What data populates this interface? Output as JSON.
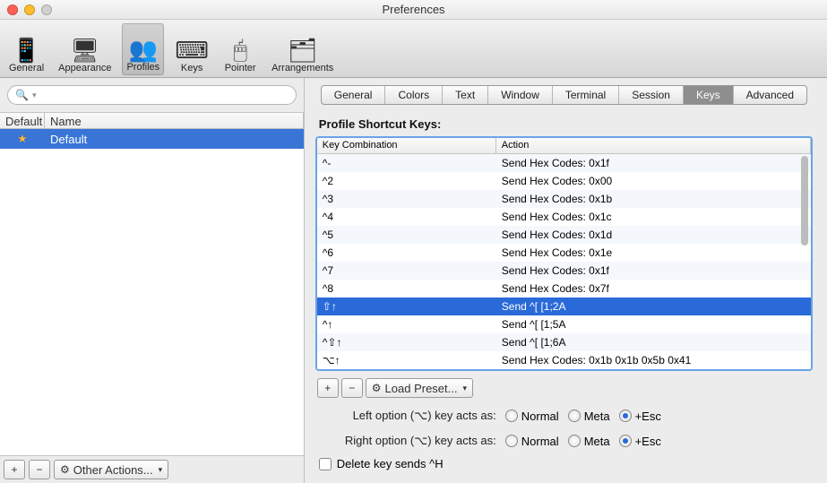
{
  "window_title": "Preferences",
  "toolbar": {
    "items": [
      {
        "label": "General",
        "icon": "📱"
      },
      {
        "label": "Appearance",
        "icon": "🖥"
      },
      {
        "label": "Profiles",
        "icon": "👥"
      },
      {
        "label": "Keys",
        "icon": "⌨"
      },
      {
        "label": "Pointer",
        "icon": "🖱"
      },
      {
        "label": "Arrangements",
        "icon": "🗂"
      }
    ],
    "selected": "Profiles"
  },
  "profiles": {
    "columns": {
      "default": "Default",
      "name": "Name"
    },
    "rows": [
      {
        "default": true,
        "name": "Default"
      }
    ],
    "buttons": {
      "add": "+",
      "remove": "−",
      "other": "Other Actions..."
    }
  },
  "right_tabs": {
    "items": [
      "General",
      "Colors",
      "Text",
      "Window",
      "Terminal",
      "Session",
      "Keys",
      "Advanced"
    ],
    "selected": "Keys"
  },
  "section_title": "Profile Shortcut Keys:",
  "keys_table": {
    "columns": {
      "key": "Key Combination",
      "action": "Action"
    },
    "rows": [
      {
        "key": "^-",
        "action": "Send Hex Codes: 0x1f"
      },
      {
        "key": "^2",
        "action": "Send Hex Codes: 0x00"
      },
      {
        "key": "^3",
        "action": "Send Hex Codes: 0x1b"
      },
      {
        "key": "^4",
        "action": "Send Hex Codes: 0x1c"
      },
      {
        "key": "^5",
        "action": "Send Hex Codes: 0x1d"
      },
      {
        "key": "^6",
        "action": "Send Hex Codes: 0x1e"
      },
      {
        "key": "^7",
        "action": "Send Hex Codes: 0x1f"
      },
      {
        "key": "^8",
        "action": "Send Hex Codes: 0x7f"
      },
      {
        "key": "⇧↑",
        "action": "Send ^[ [1;2A",
        "selected": true
      },
      {
        "key": "^↑",
        "action": "Send ^[ [1;5A"
      },
      {
        "key": "^⇧↑",
        "action": "Send ^[ [1;6A"
      },
      {
        "key": "⌥↑",
        "action": "Send Hex Codes: 0x1b 0x1b 0x5b 0x41"
      }
    ],
    "buttons": {
      "add": "+",
      "remove": "−",
      "preset": "Load Preset..."
    }
  },
  "options": {
    "left_label": "Left option (⌥) key acts as:",
    "right_label": "Right option (⌥) key acts as:",
    "choices": [
      "Normal",
      "Meta",
      "+Esc"
    ],
    "left_selected": "+Esc",
    "right_selected": "+Esc",
    "delete_label": "Delete key sends ^H",
    "delete_checked": false
  }
}
